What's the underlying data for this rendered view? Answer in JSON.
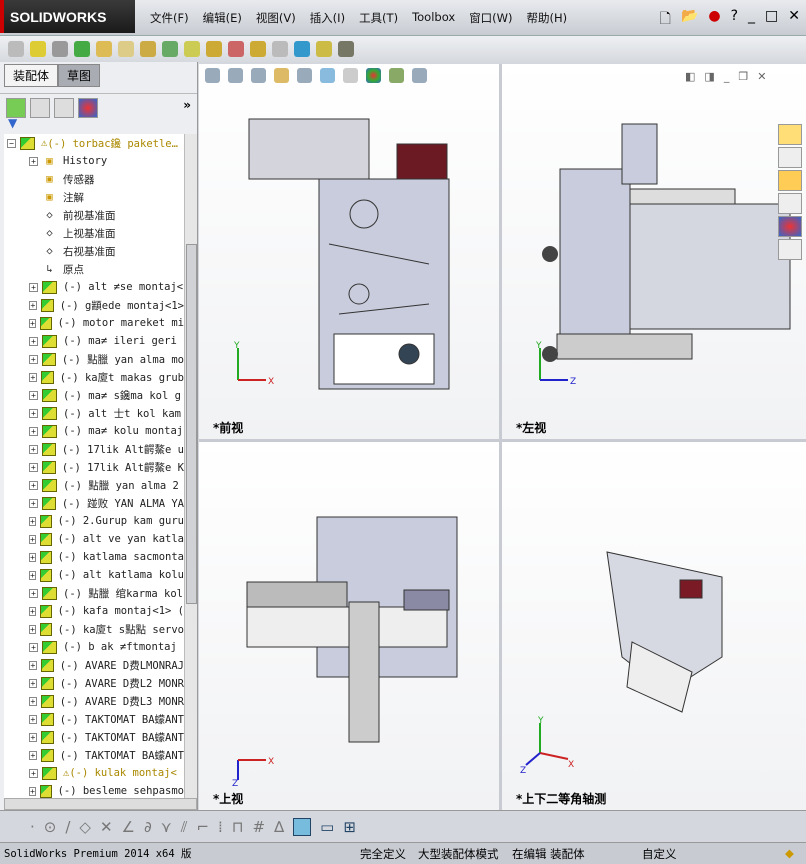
{
  "app": {
    "logo": "SOLIDWORKS",
    "menu": [
      "文件(F)",
      "编辑(E)",
      "视图(V)",
      "插入(I)",
      "工具(T)",
      "Toolbox",
      "窗口(W)",
      "帮助(H)"
    ],
    "help": "?"
  },
  "panel": {
    "tabs": [
      "装配体",
      "草图"
    ],
    "chevron": "»"
  },
  "tree": {
    "root": "(-) torbac鑱 paketle…",
    "items": [
      {
        "label": "History",
        "type": "folder",
        "exp": true
      },
      {
        "label": "传感器",
        "type": "folder"
      },
      {
        "label": "注解",
        "type": "folder"
      },
      {
        "label": "前视基准面",
        "type": "plane"
      },
      {
        "label": "上视基准面",
        "type": "plane"
      },
      {
        "label": "右视基准面",
        "type": "plane"
      },
      {
        "label": "原点",
        "type": "origin"
      },
      {
        "label": "(-) alt ≠se montaj<",
        "type": "asm"
      },
      {
        "label": "(-) g顓ede montaj<1>",
        "type": "asm"
      },
      {
        "label": "(-) motor mareket mi",
        "type": "asm"
      },
      {
        "label": "(-) ma≠ ileri geri",
        "type": "asm"
      },
      {
        "label": "(-) 點臘 yan alma mo",
        "type": "asm"
      },
      {
        "label": "(-) ka廈t makas grub",
        "type": "asm"
      },
      {
        "label": "(-) ma≠ s鑱ma kol g",
        "type": "asm"
      },
      {
        "label": "(-) alt 士t kol kam",
        "type": "asm"
      },
      {
        "label": "(-) ma≠ kolu montaj",
        "type": "asm"
      },
      {
        "label": "(-) 17lik Alt齶鰲e u",
        "type": "asm"
      },
      {
        "label": "(-) 17lik Alt齶鰲e K",
        "type": "asm"
      },
      {
        "label": "(-) 點臘 yan alma 2",
        "type": "asm"
      },
      {
        "label": "(-) 踫败 YAN ALMA YA",
        "type": "asm"
      },
      {
        "label": "(-) 2.Gurup kam guru",
        "type": "asm"
      },
      {
        "label": "(-) alt ve yan katla",
        "type": "asm"
      },
      {
        "label": "(-) katlama sacmonta",
        "type": "asm"
      },
      {
        "label": "(-) alt katlama kolu",
        "type": "asm"
      },
      {
        "label": "(-) 點臘 绾karma kol",
        "type": "asm"
      },
      {
        "label": "(-) kafa montaj<1> (",
        "type": "asm"
      },
      {
        "label": "(-) ka廈t s點點 servo",
        "type": "asm"
      },
      {
        "label": "(-) b  ak ≠ftmontaj",
        "type": "asm"
      },
      {
        "label": "(-) AVARE D费LMONRAJ",
        "type": "asm"
      },
      {
        "label": "(-) AVARE D费L2 MONR",
        "type": "asm"
      },
      {
        "label": "(-) AVARE D费L3 MONR",
        "type": "asm"
      },
      {
        "label": "(-) TAKTOMAT BA蠓ANT",
        "type": "asm"
      },
      {
        "label": "(-) TAKTOMAT BA蠓ANT",
        "type": "asm"
      },
      {
        "label": "(-) TAKTOMAT BA蠓ANT",
        "type": "asm"
      },
      {
        "label": "(-) kulak montaj<",
        "type": "asm",
        "warn": true
      },
      {
        "label": "(-) besleme sehpasmo",
        "type": "asm"
      }
    ]
  },
  "viewports": [
    {
      "label": "*前视"
    },
    {
      "label": "*左视"
    },
    {
      "label": "*上视"
    },
    {
      "label": "*上下二等角轴测"
    }
  ],
  "axes": {
    "x": "X",
    "y": "Y",
    "z": "Z"
  },
  "status": {
    "version": "SolidWorks Premium 2014 x64 版",
    "s1": "完全定义",
    "s2": "大型装配体模式",
    "s3": "在编辑 装配体",
    "s4": "自定义"
  }
}
